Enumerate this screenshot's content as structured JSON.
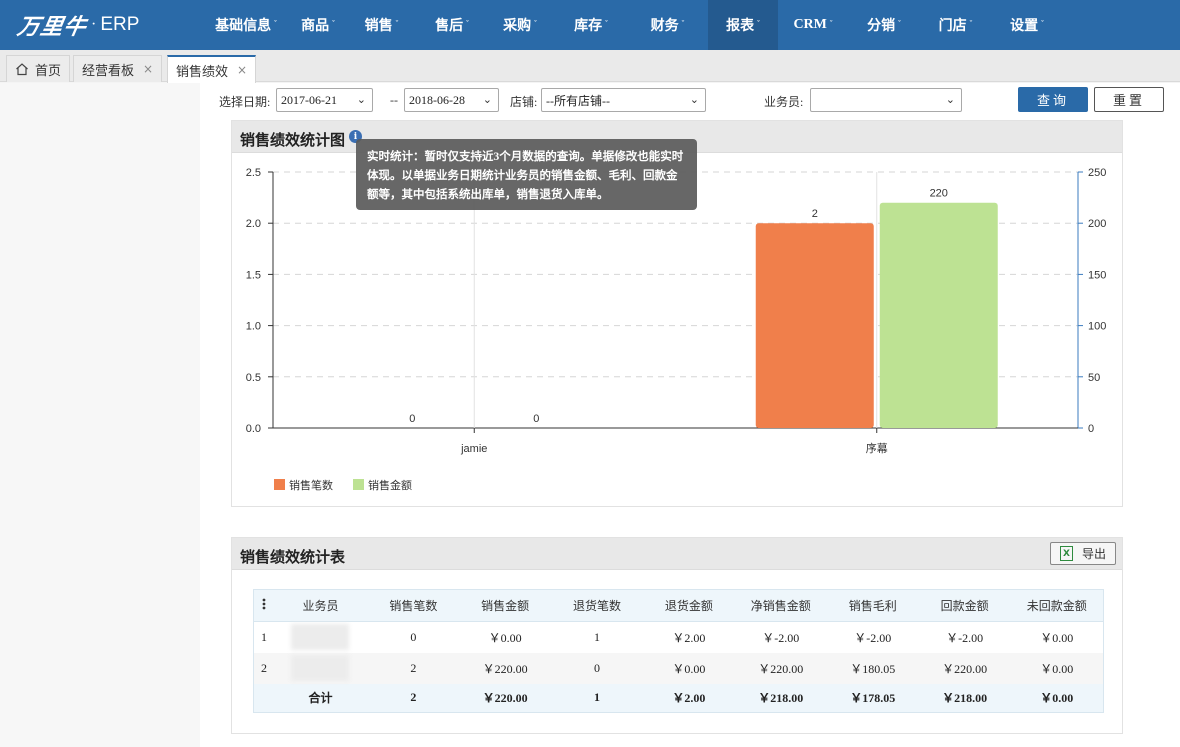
{
  "app": {
    "logo_text": "万里牛",
    "logo_sep": "·",
    "logo_suffix": "ERP"
  },
  "menu": [
    {
      "label": "基础信息",
      "caret": "ˇ"
    },
    {
      "label": "商品",
      "caret": "ˇ"
    },
    {
      "label": "销售",
      "caret": "ˇ"
    },
    {
      "label": "售后",
      "caret": "ˇ"
    },
    {
      "label": "采购",
      "caret": "ˇ"
    },
    {
      "label": "库存",
      "caret": "ˇ"
    },
    {
      "label": "财务",
      "caret": "ˇ"
    },
    {
      "label": "报表",
      "caret": "ˇ",
      "active": true
    },
    {
      "label": "CRM",
      "caret": "ˇ"
    },
    {
      "label": "分销",
      "caret": "ˇ"
    },
    {
      "label": "门店",
      "caret": "ˇ"
    },
    {
      "label": "设置",
      "caret": "ˇ"
    }
  ],
  "tabs": [
    {
      "label": "首页",
      "icon": "home-icon"
    },
    {
      "label": "经营看板",
      "close": "×"
    },
    {
      "label": "销售绩效",
      "close": "×",
      "active": true
    }
  ],
  "filters": {
    "date_label": "选择日期:",
    "date_from": "2017-06-21",
    "date_sep": "--",
    "date_to": "2018-06-28",
    "store_label": "店铺:",
    "store_value": "--所有店铺--",
    "salesman_label": "业务员:",
    "salesman_value": "",
    "query_button": "查询",
    "reset_button": "重置"
  },
  "chart_panel": {
    "title": "销售绩效统计图",
    "info_icon": "i",
    "tooltip": "实时统计：暂时仅支持近3个月数据的查询。单据修改也能实时体现。以单据业务日期统计业务员的销售金额、毛利、回款金额等，其中包括系统出库单，销售退货入库单。"
  },
  "chart_data": {
    "type": "bar",
    "categories": [
      "jamie",
      "序幕"
    ],
    "series": [
      {
        "name": "销售笔数",
        "values": [
          0,
          2
        ],
        "axis": "left",
        "color": "#f07f4b"
      },
      {
        "name": "销售金额",
        "values": [
          0,
          220
        ],
        "axis": "right",
        "color": "#bde293"
      }
    ],
    "ylim_left": [
      0,
      2.5
    ],
    "ylim_right": [
      0,
      250
    ],
    "yticks_left": [
      "0.0",
      "0.5",
      "1.0",
      "1.5",
      "2.0",
      "2.5"
    ],
    "yticks_right": [
      "0",
      "50",
      "100",
      "150",
      "200",
      "250"
    ],
    "grid": true,
    "legend": "bottom-left"
  },
  "table_panel": {
    "title": "销售绩效统计表",
    "export_label": "导出",
    "columns": [
      "业务员",
      "销售笔数",
      "销售金额",
      "退货笔数",
      "退货金额",
      "净销售金额",
      "销售毛利",
      "回款金额",
      "未回款金额"
    ],
    "rows": [
      {
        "idx": "1",
        "cells": [
          "0",
          "￥0.00",
          "1",
          "￥2.00",
          "￥-2.00",
          "￥-2.00",
          "￥-2.00",
          "￥0.00"
        ]
      },
      {
        "idx": "2",
        "cells": [
          "2",
          "￥220.00",
          "0",
          "￥0.00",
          "￥220.00",
          "￥180.05",
          "￥220.00",
          "￥0.00"
        ]
      }
    ],
    "total_label": "合计",
    "total": [
      "2",
      "￥220.00",
      "1",
      "￥2.00",
      "￥218.00",
      "￥178.05",
      "￥218.00",
      "￥0.00"
    ]
  }
}
